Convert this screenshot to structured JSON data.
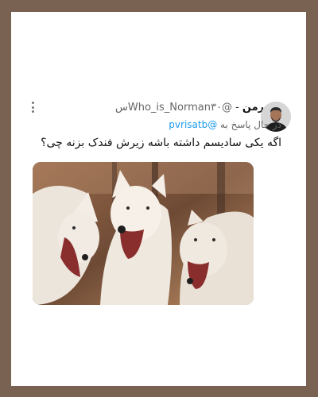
{
  "tweet": {
    "display_name": "نورمن",
    "handle": "@Who_is_Norman",
    "time": "۳۰س",
    "reply_prefix": "در حال پاسخ به",
    "reply_to": "@pvrisatb",
    "text": "اگه یکی سادیسم داشته باشه زیرش فندک بزنه چی؟"
  },
  "icons": {
    "more": "more-vertical-icon",
    "avatar": "user-avatar"
  },
  "colors": {
    "frame": "#7a6253",
    "link": "#1d9bf0"
  }
}
